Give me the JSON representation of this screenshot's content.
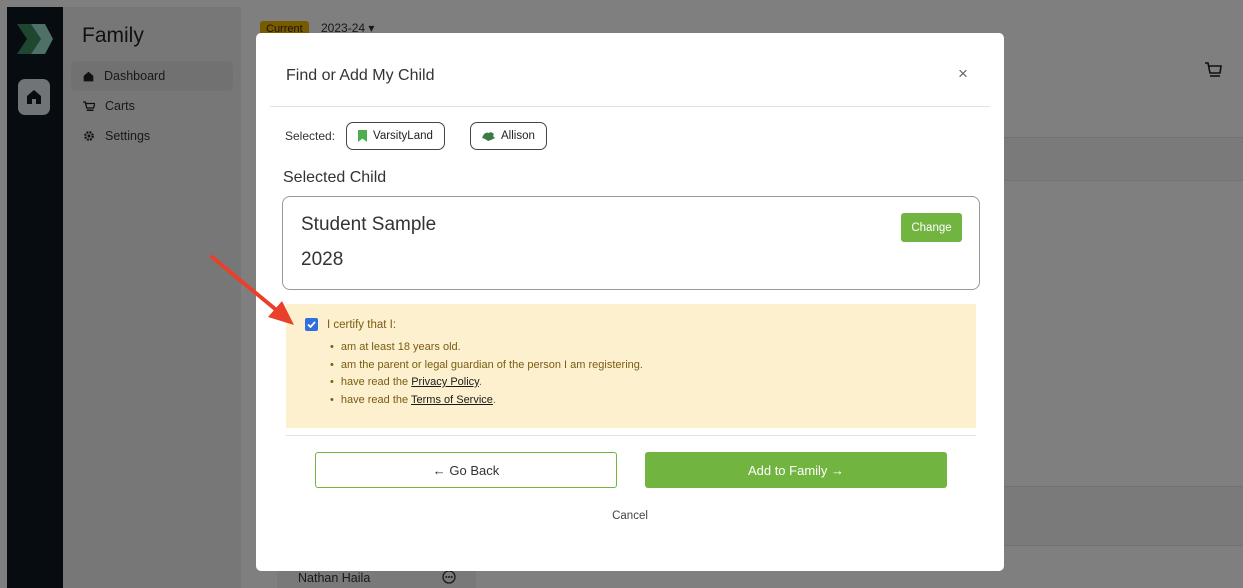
{
  "app": {
    "section_title": "Family",
    "nav": [
      {
        "label": "Dashboard",
        "icon": "home-icon"
      },
      {
        "label": "Carts",
        "icon": "cart-icon"
      },
      {
        "label": "Settings",
        "icon": "gear-icon"
      }
    ],
    "season_badge": "Current",
    "season_label": "2023-24 ▾",
    "member_name": "Nathan Haila"
  },
  "modal": {
    "title": "Find or Add My Child",
    "close": "×",
    "selected_label": "Selected:",
    "chips": [
      {
        "label": "VarsityLand",
        "icon": "bookmark-icon"
      },
      {
        "label": "Allison",
        "icon": "map-region-icon"
      }
    ],
    "selected_child_title": "Selected Child",
    "child": {
      "name": "Student Sample",
      "year": "2028"
    },
    "change_label": "Change",
    "certify": {
      "checked": true,
      "heading": "I certify that I:",
      "items": {
        "age": "am at least 18 years old.",
        "guardian": "am the parent or legal guardian of the person I am registering.",
        "privacy_prefix": "have read the ",
        "privacy_link": "Privacy Policy",
        "privacy_suffix": ".",
        "terms_prefix": "have read the ",
        "terms_link": "Terms of Service",
        "terms_suffix": "."
      }
    },
    "back_label": "← Go Back",
    "add_label": "Add to Family →",
    "cancel_label": "Cancel"
  },
  "colors": {
    "brand_green": "#72b440",
    "rail_dark": "#0f1923",
    "cert_background": "#fdf0cf",
    "cert_text": "#7a5c12",
    "annotation_arrow": "#e8402a"
  }
}
